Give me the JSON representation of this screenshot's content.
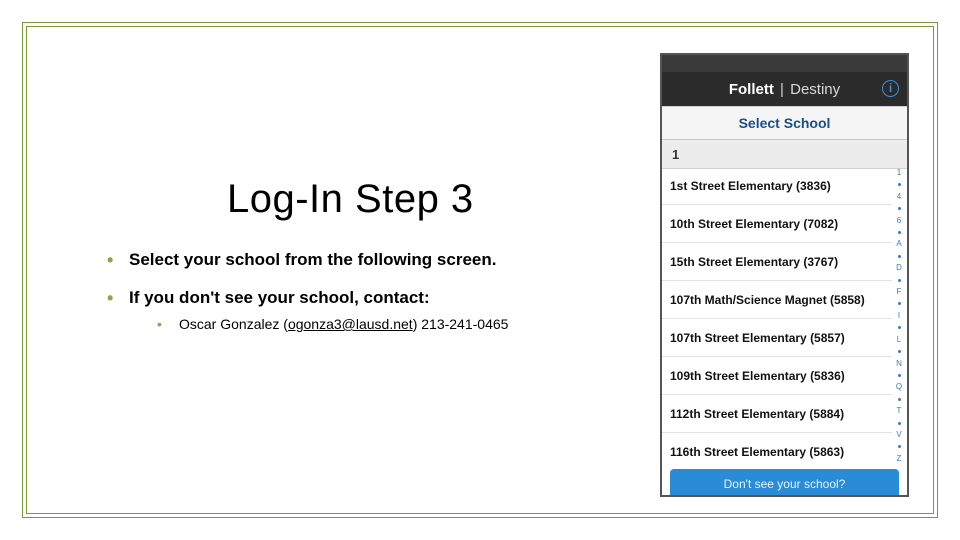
{
  "slide": {
    "title": "Log-In Step 3",
    "bullets": [
      "Select your school from the following screen.",
      "If you don't see your school, contact:"
    ],
    "contact": {
      "name": "Oscar Gonzalez",
      "email": "ogonza3@lausd.net",
      "phone": "213-241-0465"
    }
  },
  "phone": {
    "brand_bold": "Follett",
    "brand_sep": "|",
    "brand_light": "Destiny",
    "info_glyph": "i",
    "select_label": "Select School",
    "section_header": "1",
    "schools": [
      "1st Street Elementary (3836)",
      "10th Street Elementary (7082)",
      "15th Street Elementary (3767)",
      "107th Math/Science Magnet (5858)",
      "107th Street Elementary (5857)",
      "109th Street Elementary (5836)",
      "112th Street Elementary (5884)",
      "116th Street Elementary (5863)"
    ],
    "index_rail": [
      "1",
      "",
      "4",
      "",
      "6",
      "",
      "A",
      "",
      "D",
      "",
      "F",
      "",
      "I",
      "",
      "L",
      "",
      "N",
      "",
      "Q",
      "",
      "T",
      "",
      "V",
      "",
      "Z"
    ],
    "bottom_button": "Don't see your school?"
  }
}
